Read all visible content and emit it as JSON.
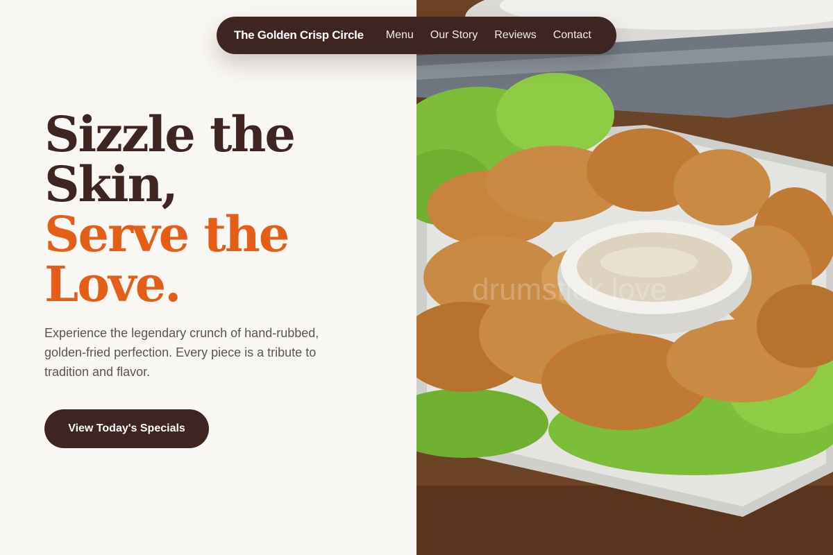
{
  "nav": {
    "brand": "The Golden Crisp Circle",
    "links": [
      "Menu",
      "Our Story",
      "Reviews",
      "Contact"
    ]
  },
  "hero": {
    "headline_line1": "Sizzle the",
    "headline_line2": "Skin,",
    "headline_accent_line1": "Serve the",
    "headline_accent_line2": "Love.",
    "description": "Experience the legendary crunch of hand-rubbed, golden-fried perfection. Every piece is a tribute to tradition and flavor.",
    "cta_label": "View Today's Specials",
    "image_watermark": "drumstick.love"
  },
  "colors": {
    "primary": "#3d2622",
    "accent": "#e45e17",
    "background": "#f9f7f3",
    "body_text": "#5a5552"
  }
}
